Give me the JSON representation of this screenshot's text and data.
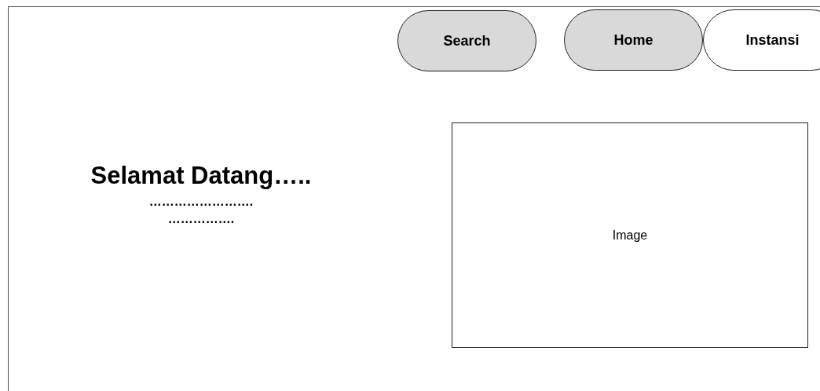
{
  "nav": [
    {
      "label": "Search",
      "selected": true
    },
    {
      "label": "Home",
      "selected": true
    },
    {
      "label": "Instansi",
      "selected": false
    }
  ],
  "welcome": {
    "title": "Selamat Datang…..",
    "lines": [
      "…………………….",
      "……………."
    ]
  },
  "image": {
    "label": "Image"
  }
}
